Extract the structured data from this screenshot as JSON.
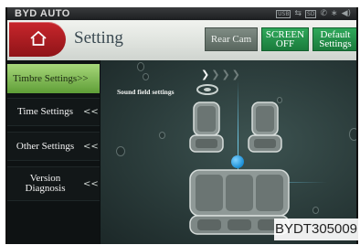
{
  "statusbar": {
    "brand": "BYD AUTO",
    "icons": [
      "usb-icon",
      "sd-card-icon",
      "phone-icon",
      "bluetooth-icon",
      "volume-icon"
    ]
  },
  "header": {
    "title": "Setting",
    "buttons": {
      "rear_cam": "Rear Cam",
      "screen_off": [
        "SCREEN",
        "OFF"
      ],
      "default_settings": [
        "Default",
        "Settings"
      ]
    }
  },
  "sidebar": {
    "items": [
      {
        "label": "Timbre Settings>>",
        "selected": true
      },
      {
        "label": "Time Settings",
        "arrow": "<<"
      },
      {
        "label": "Other Settings",
        "arrow": "<<"
      },
      {
        "label": [
          "Version",
          "Diagnosis"
        ],
        "arrow": "<<"
      }
    ]
  },
  "main": {
    "sound_field_label": "Sound field settings",
    "progress": {
      "total": 4,
      "active": 1
    }
  },
  "watermark": "BYDT305009",
  "colors": {
    "accent_green": "#2fa85a",
    "selected_item": "#8cc65c",
    "home_red": "#b51f25",
    "focus_blue": "#1b8fd6"
  }
}
